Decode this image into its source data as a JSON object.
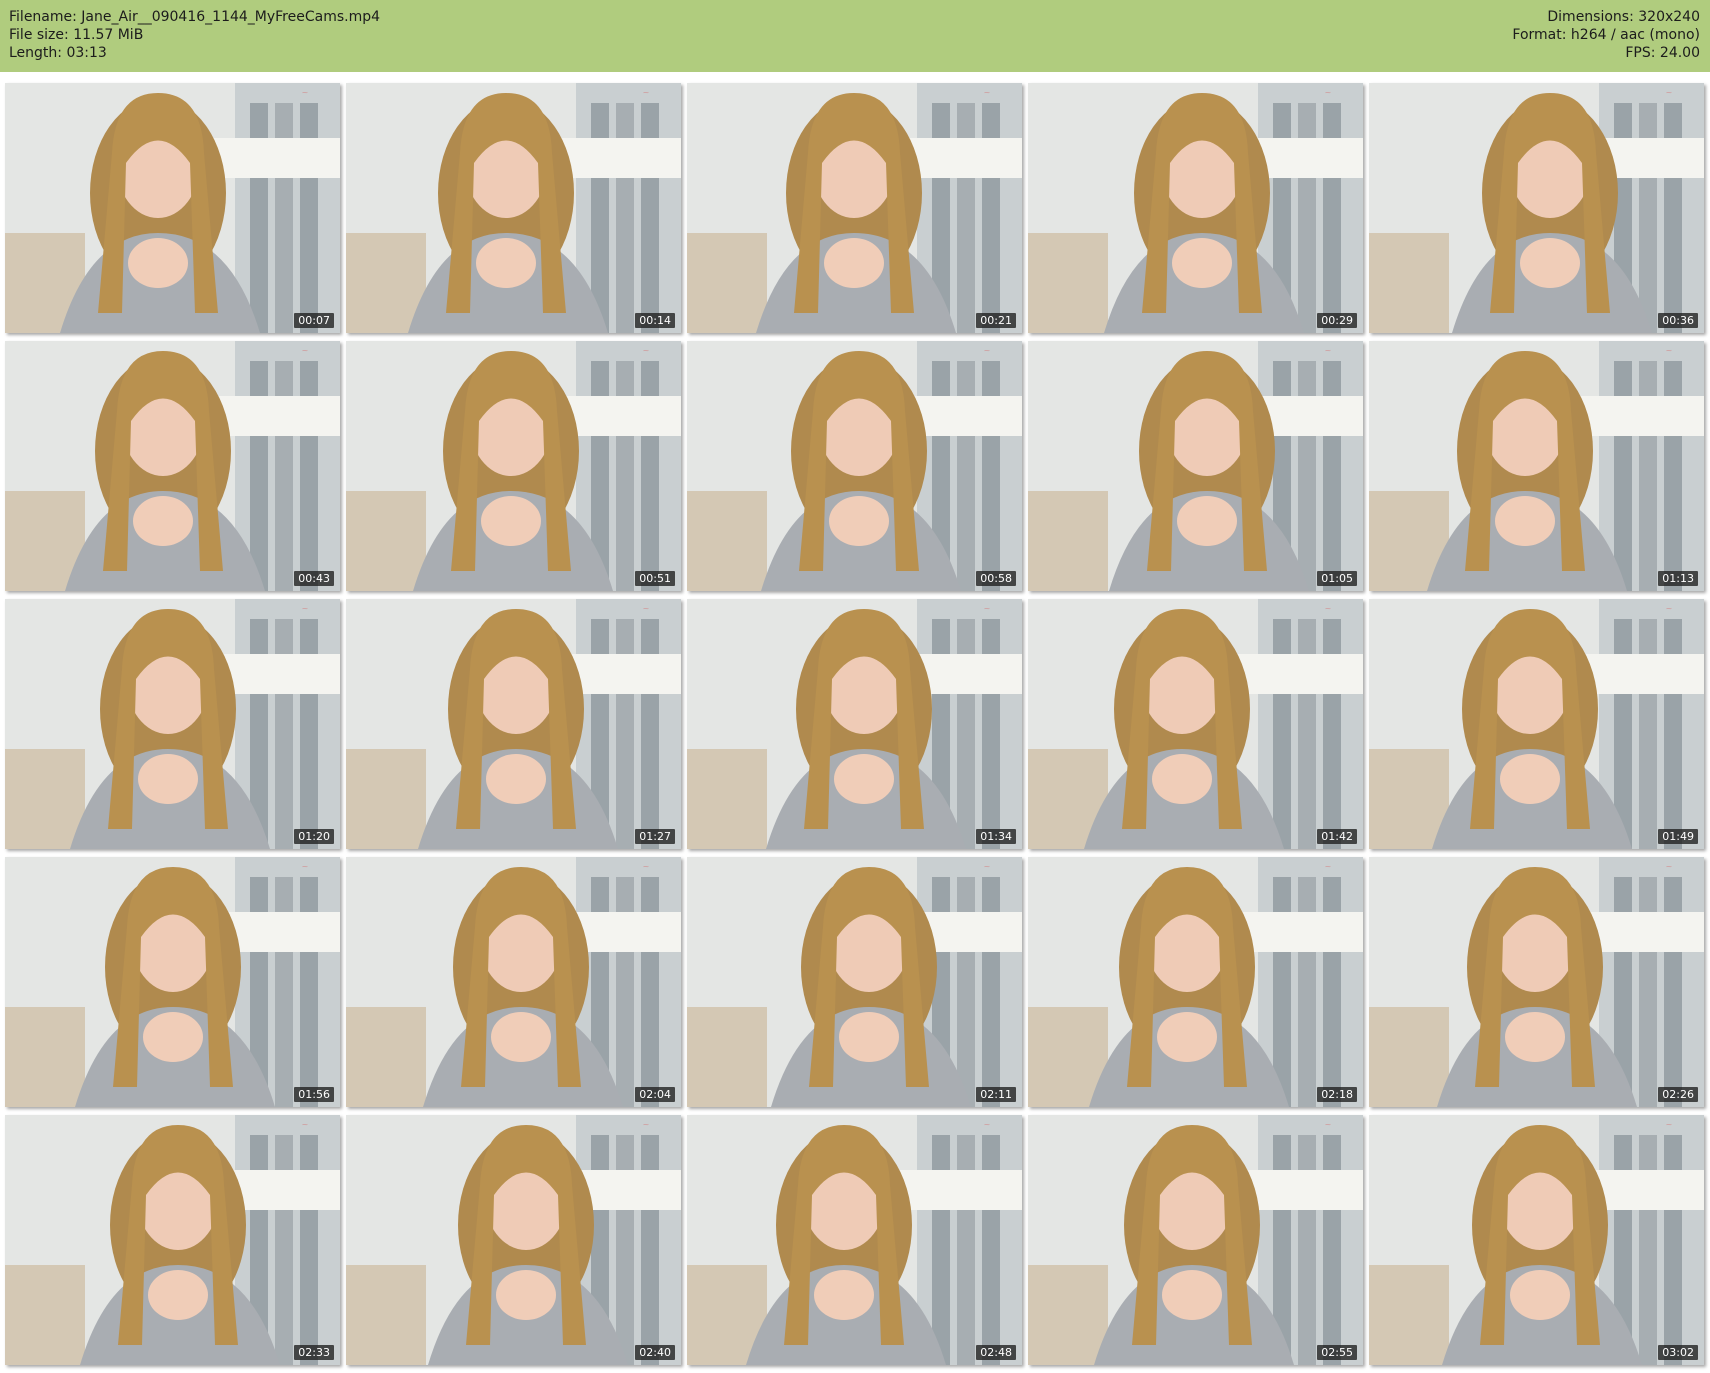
{
  "header": {
    "filename_label": "Filename: Jane_Air__090416_1144_MyFreeCams.mp4",
    "filesize_label": "File size: 11.57 MiB",
    "length_label": "Length: 03:13",
    "dimensions_label": "Dimensions: 320x240",
    "format_label": "Format: h264 / aac (mono)",
    "fps_label": "FPS: 24.00",
    "background_color": "#b0cc7e"
  },
  "thumbnails": [
    {
      "time": "00:07"
    },
    {
      "time": "00:14"
    },
    {
      "time": "00:21"
    },
    {
      "time": "00:29"
    },
    {
      "time": "00:36"
    },
    {
      "time": "00:43"
    },
    {
      "time": "00:51"
    },
    {
      "time": "00:58"
    },
    {
      "time": "01:05"
    },
    {
      "time": "01:13"
    },
    {
      "time": "01:20"
    },
    {
      "time": "01:27"
    },
    {
      "time": "01:34"
    },
    {
      "time": "01:42"
    },
    {
      "time": "01:49"
    },
    {
      "time": "01:56"
    },
    {
      "time": "02:04"
    },
    {
      "time": "02:11"
    },
    {
      "time": "02:18"
    },
    {
      "time": "02:26"
    },
    {
      "time": "02:33"
    },
    {
      "time": "02:40"
    },
    {
      "time": "02:48"
    },
    {
      "time": "02:55"
    },
    {
      "time": "03:02"
    }
  ],
  "grid": {
    "columns": 5,
    "rows": 5
  }
}
